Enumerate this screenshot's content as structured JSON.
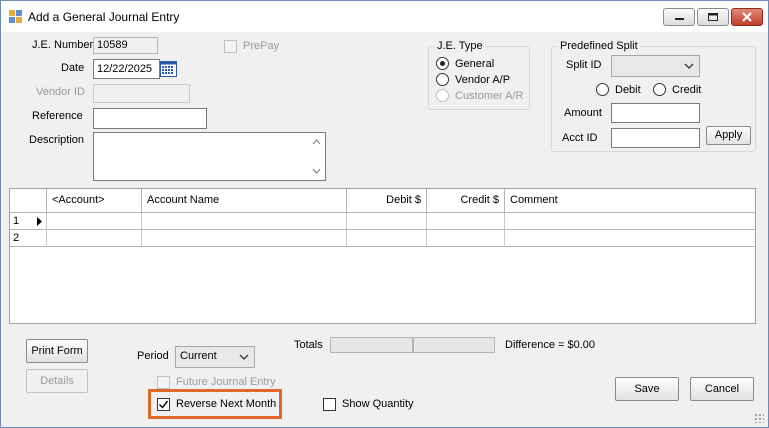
{
  "window": {
    "title": "Add a General Journal Entry"
  },
  "form": {
    "je_number_label": "J.E. Number",
    "je_number_value": "10589",
    "date_label": "Date",
    "date_value": "12/22/2025",
    "vendor_id_label": "Vendor ID",
    "vendor_id_value": "",
    "reference_label": "Reference",
    "reference_value": "",
    "description_label": "Description",
    "description_value": "",
    "prepay_label": "PrePay"
  },
  "je_type": {
    "title": "J.E. Type",
    "options": [
      {
        "label": "General",
        "selected": true,
        "enabled": true
      },
      {
        "label": "Vendor A/P",
        "selected": false,
        "enabled": true
      },
      {
        "label": "Customer A/R",
        "selected": false,
        "enabled": false
      }
    ]
  },
  "predefined_split": {
    "title": "Predefined Split",
    "split_id_label": "Split ID",
    "split_id_value": "",
    "debit_label": "Debit",
    "credit_label": "Credit",
    "amount_label": "Amount",
    "amount_value": "",
    "acct_id_label": "Acct ID",
    "acct_id_value": "",
    "apply_label": "Apply"
  },
  "grid": {
    "columns": [
      "<Account>",
      "Account Name",
      "Debit $",
      "Credit $",
      "Comment"
    ],
    "rows": [
      {
        "num": "1",
        "current": true,
        "cells": [
          "",
          "",
          "",
          "",
          ""
        ]
      },
      {
        "num": "2",
        "current": false,
        "cells": [
          "",
          "",
          "",
          "",
          ""
        ]
      }
    ]
  },
  "bottom": {
    "print_form_label": "Print Form",
    "details_label": "Details",
    "period_label": "Period",
    "period_value": "Current",
    "totals_label": "Totals",
    "debit_total": "",
    "credit_total": "",
    "difference_label": "Difference = $0.00",
    "future_je_label": "Future Journal Entry",
    "reverse_next_month_label": "Reverse Next Month",
    "reverse_next_month_checked": true,
    "show_quantity_label": "Show Quantity",
    "show_quantity_checked": false,
    "save_label": "Save",
    "cancel_label": "Cancel"
  },
  "colors": {
    "highlight": "#e0692a",
    "window_border": "#6b8bb5"
  },
  "icons": [
    "app-icon",
    "calendar-icon",
    "minimize-icon",
    "maximize-icon",
    "close-icon",
    "row-pointer-icon",
    "size-grip-icon"
  ]
}
